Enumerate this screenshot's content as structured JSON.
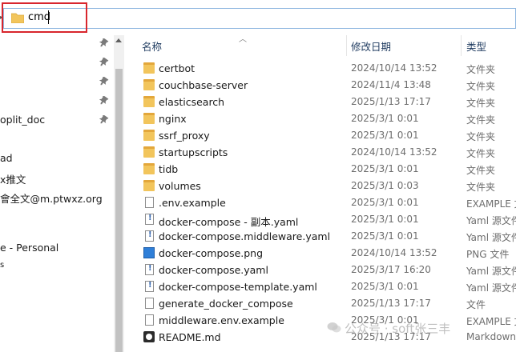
{
  "address": {
    "path": "cmd"
  },
  "nav": {
    "items": [
      "oplit_doc",
      "ad",
      "x推文",
      "會全文@m.ptwxz.org",
      "e - Personal",
      "s"
    ]
  },
  "columns": {
    "name": "名称",
    "date": "修改日期",
    "type": "类型"
  },
  "files": [
    {
      "name": "certbot",
      "date": "2024/10/14 13:52",
      "type": "文件夹",
      "kind": "folder"
    },
    {
      "name": "couchbase-server",
      "date": "2024/11/4 13:48",
      "type": "文件夹",
      "kind": "folder"
    },
    {
      "name": "elasticsearch",
      "date": "2025/1/13 17:17",
      "type": "文件夹",
      "kind": "folder"
    },
    {
      "name": "nginx",
      "date": "2025/3/1 0:01",
      "type": "文件夹",
      "kind": "folder"
    },
    {
      "name": "ssrf_proxy",
      "date": "2025/3/1 0:01",
      "type": "文件夹",
      "kind": "folder"
    },
    {
      "name": "startupscripts",
      "date": "2024/10/14 13:52",
      "type": "文件夹",
      "kind": "folder"
    },
    {
      "name": "tidb",
      "date": "2025/3/1 0:01",
      "type": "文件夹",
      "kind": "folder"
    },
    {
      "name": "volumes",
      "date": "2025/3/1 0:03",
      "type": "文件夹",
      "kind": "folder"
    },
    {
      "name": ".env.example",
      "date": "2025/3/1 0:01",
      "type": "EXAMPLE 文",
      "kind": "doc"
    },
    {
      "name": "docker-compose - 副本.yaml",
      "date": "2025/3/1 0:01",
      "type": "Yaml 源文件",
      "kind": "yaml"
    },
    {
      "name": "docker-compose.middleware.yaml",
      "date": "2025/3/1 0:01",
      "type": "Yaml 源文件",
      "kind": "yaml"
    },
    {
      "name": "docker-compose.png",
      "date": "2024/10/14 13:52",
      "type": "PNG 文件",
      "kind": "png"
    },
    {
      "name": "docker-compose.yaml",
      "date": "2025/3/17 16:20",
      "type": "Yaml 源文件",
      "kind": "yaml"
    },
    {
      "name": "docker-compose-template.yaml",
      "date": "2025/3/1 0:01",
      "type": "Yaml 源文件",
      "kind": "yaml"
    },
    {
      "name": "generate_docker_compose",
      "date": "2025/1/13 17:17",
      "type": "文件",
      "kind": "doc"
    },
    {
      "name": "middleware.env.example",
      "date": "2025/3/1 0:01",
      "type": "EXAMPLE 文",
      "kind": "doc"
    },
    {
      "name": "README.md",
      "date": "2025/1/13 17:17",
      "type": "Markdown",
      "kind": "md"
    }
  ],
  "watermark": {
    "text": "公众号 · soft张三丰"
  }
}
